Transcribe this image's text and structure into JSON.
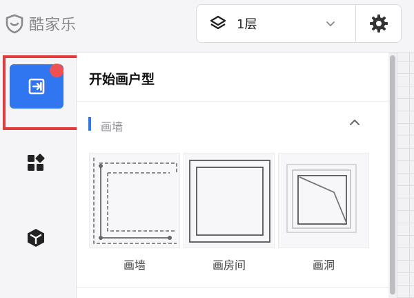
{
  "app": {
    "name": "酷家乐"
  },
  "toolbar": {
    "floor_label": "1层"
  },
  "panel": {
    "title": "开始画户型",
    "section": {
      "label": "画墙"
    },
    "tools": [
      {
        "label": "画墙"
      },
      {
        "label": "画房间"
      },
      {
        "label": "画洞"
      }
    ]
  },
  "colors": {
    "accent": "#2f76f0",
    "highlight_frame": "#e23b3b",
    "badge": "#f0504f"
  }
}
